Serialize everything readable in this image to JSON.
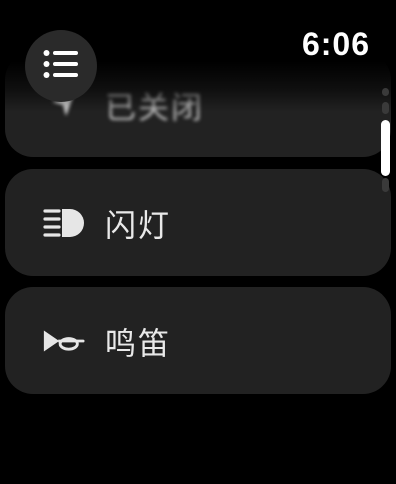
{
  "status": {
    "time": "6:06"
  },
  "menu": {
    "icon": "list-icon"
  },
  "items": [
    {
      "label": "已关闭",
      "icon": "location-arrow-icon"
    },
    {
      "label": "闪灯",
      "icon": "headlight-icon"
    },
    {
      "label": "鸣笛",
      "icon": "horn-icon"
    }
  ],
  "colors": {
    "background": "#000000",
    "card": "#222222",
    "text": "#e9e9e9",
    "accent": "#ffffff"
  }
}
